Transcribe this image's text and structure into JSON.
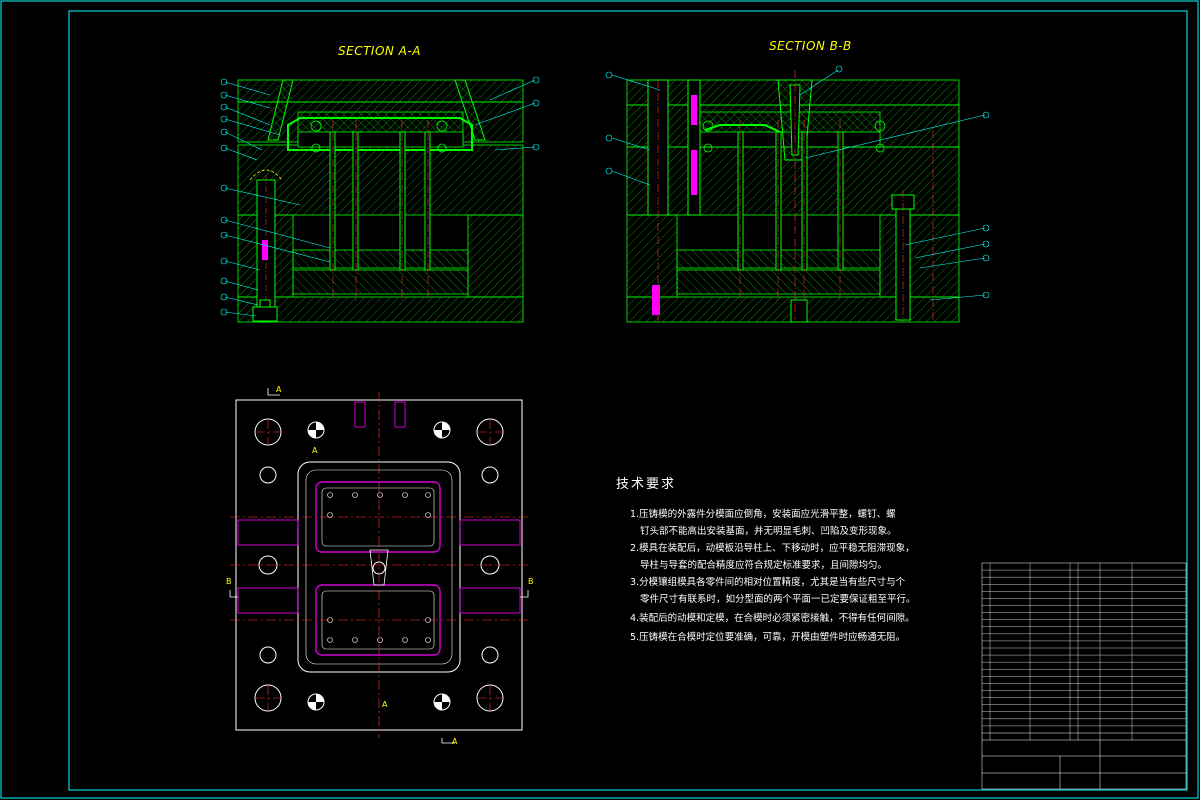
{
  "drawing": {
    "section_a_title": "SECTION A-A",
    "section_b_title": "SECTION B-B",
    "marks": {
      "top_a": "A",
      "bottom_a": "A",
      "left_b": "B",
      "right_b": "B",
      "inner_a1": "A",
      "inner_a2": "A"
    },
    "colors": {
      "frame": "#00ffff",
      "outline": "#00ff00",
      "hatch": "#00aa00",
      "center": "#ff3030",
      "ejector": "#ff00ff",
      "text": "#ffffff",
      "title": "#ffff00"
    }
  },
  "tech_requirements": {
    "title": "技术要求",
    "lines": [
      "1.压铸模的外露件分模面应倒角，安装面应光滑平整，螺钉、螺",
      "钉头部不能高出安装基面，并无明显毛刺、凹陷及变形现象。",
      "2.模具在装配后，动模板沿导柱上、下移动时，应平稳无阻滞现象，",
      "导柱与导套的配合精度应符合规定标准要求，且间隙均匀。",
      "3.分模镶组模具各零件间的相对位置精度，尤其是当有些尺寸与个",
      "零件尺寸有联系时，如分型面的两个平面一已定要保证粗至平行。",
      "4.装配后的动模和定模，在合模时必须紧密接触，不得有任何间隙。",
      "5.压铸模在合模时定位要准确，可靠，开模由塑件时应畅通无阻。"
    ]
  },
  "title_block": {
    "rows": 24
  }
}
